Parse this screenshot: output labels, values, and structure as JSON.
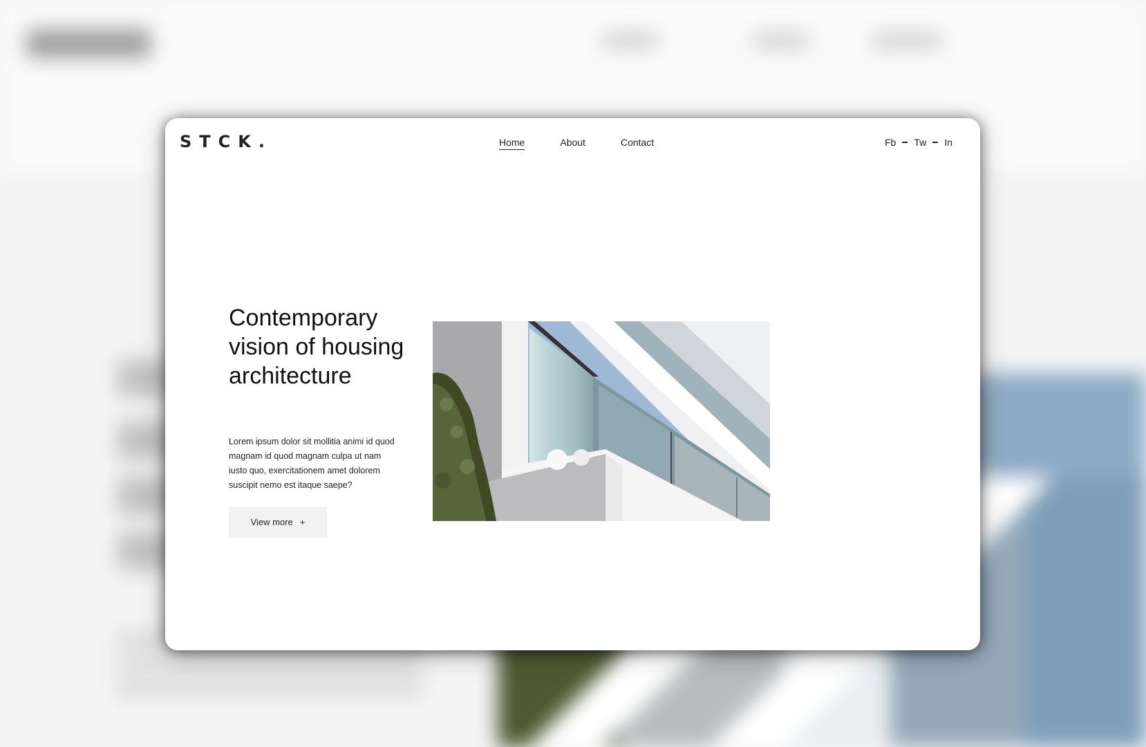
{
  "brand": {
    "logo": "STCK."
  },
  "nav": {
    "items": [
      {
        "label": "Home",
        "active": true
      },
      {
        "label": "About",
        "active": false
      },
      {
        "label": "Contact",
        "active": false
      }
    ]
  },
  "social": {
    "items": [
      "Fb",
      "Tw",
      "In"
    ]
  },
  "hero": {
    "title": "Contemporary vision of housing architecture",
    "body": "Lorem ipsum dolor sit mollitia animi id quod magnam id quod magnam culpa ut nam iusto quo, exercitationem amet dolorem suscipit nemo est itaque saepe?",
    "cta_label": "View more",
    "cta_icon": "+",
    "image_alt": "Modern white building balcony with glass railings"
  },
  "colors": {
    "text": "#222222",
    "background": "#ffffff",
    "button_bg": "#f2f2f2",
    "sky": "#9db8d3"
  }
}
